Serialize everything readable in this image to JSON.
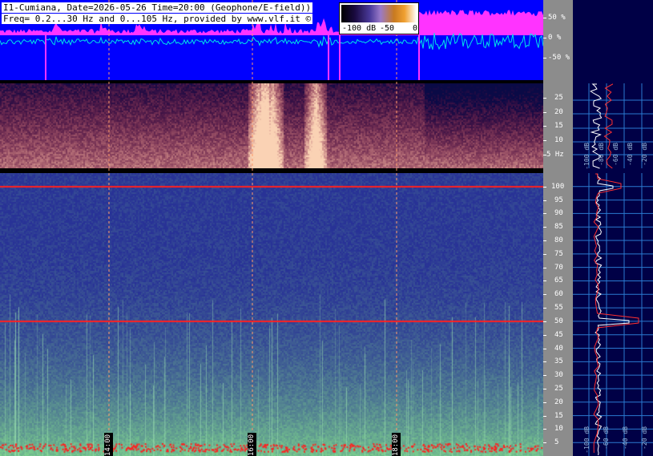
{
  "header": {
    "line1": "I1-Cumiana, Date=2026-05-26 Time=20:00 (Geophone/E-field))",
    "line2": "Freq= 0.2...30 Hz and 0...105 Hz, provided by www.vlf.it ©"
  },
  "colorbar": {
    "labels": [
      "-100 dB",
      "-50",
      "0"
    ]
  },
  "chart_data": [
    {
      "type": "line",
      "panel": "waveform",
      "yticks": [
        "50 %",
        "0 %",
        "-50 %"
      ],
      "ylim": [
        -100,
        100
      ],
      "colors": {
        "background": "#0000ff",
        "trace": "#00e5e5",
        "envelope": "#ff33ff"
      }
    },
    {
      "type": "heatmap",
      "panel": "spectrogram-0.2-30Hz",
      "yticks": [
        "25",
        "20",
        "15",
        "10",
        "5 Hz"
      ],
      "yvalues": [
        25,
        20,
        15,
        10,
        5
      ],
      "ylim": [
        0.2,
        30
      ],
      "bright_bands_x": [
        0.475,
        0.5,
        0.58
      ],
      "colors": {
        "low": "#0a0a28",
        "mid": "#8a4a20",
        "high": "#ffe0a0"
      }
    },
    {
      "type": "heatmap",
      "panel": "spectrogram-0-105Hz",
      "yticks": [
        "100",
        "95",
        "90",
        "85",
        "80",
        "75",
        "70",
        "65",
        "60",
        "55",
        "50",
        "45",
        "40",
        "35",
        "30",
        "25",
        "20",
        "15",
        "10",
        "5"
      ],
      "yvalues": [
        100,
        95,
        90,
        85,
        80,
        75,
        70,
        65,
        60,
        55,
        50,
        45,
        40,
        35,
        30,
        25,
        20,
        15,
        10,
        5
      ],
      "ylim": [
        0,
        105
      ],
      "hum_lines_hz": [
        100,
        50
      ],
      "xticks": [
        "14:00",
        "16:00",
        "18:00"
      ],
      "xtick_fraction": [
        0.2,
        0.465,
        0.73
      ],
      "colors": {
        "low": "#2a3a9a",
        "high": "#7fd0a0",
        "hum": "#ff2020"
      }
    },
    {
      "type": "line",
      "panel": "profile",
      "xticks_top": [
        "-100 dB",
        "-80 dB",
        "-60 dB",
        "-40 dB",
        "-20 dB"
      ],
      "xticks_bottom": [
        "-100 dB",
        "-60 dB",
        "-40 dB",
        "-20 dB"
      ],
      "peak_hz": [
        100,
        50
      ],
      "colors": {
        "mean": "#ffffff",
        "max": "#ff3030",
        "grid": "#2a7ad0"
      }
    }
  ]
}
